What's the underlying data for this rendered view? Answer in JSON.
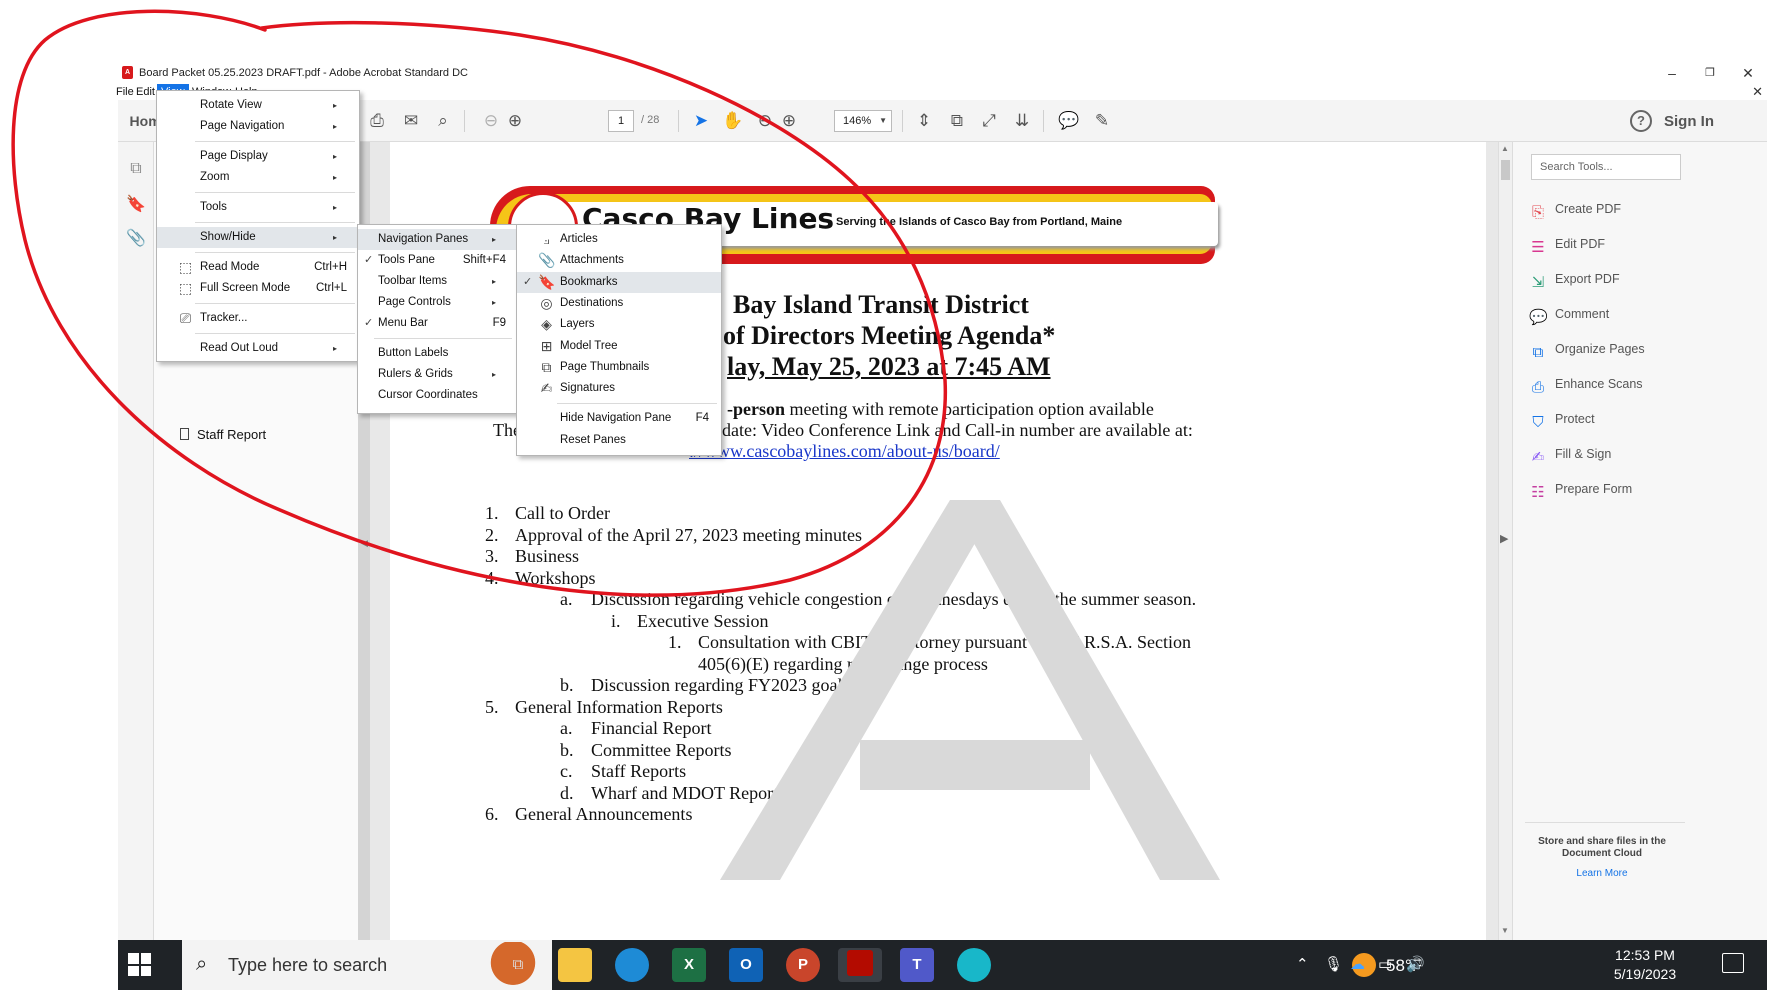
{
  "window": {
    "title": "Board Packet 05.25.2023 DRAFT.pdf - Adobe Acrobat Standard DC",
    "menus": [
      "File",
      "Edit",
      "View",
      "Window",
      "Help"
    ],
    "active_menu": "View"
  },
  "toolbar": {
    "home_label": "Home",
    "page_current": "1",
    "page_total": "/ 28",
    "zoom": "146%",
    "sign_in": "Sign In",
    "help": "?"
  },
  "nav_pane": {
    "bookmark_item": "Staff Report"
  },
  "view_menu": {
    "items": [
      {
        "label": "Rotate View",
        "shortcut": "",
        "submenu": true
      },
      {
        "label": "Page Navigation",
        "shortcut": "",
        "submenu": true
      },
      {
        "label": "Page Display",
        "shortcut": "",
        "submenu": true
      },
      {
        "label": "Zoom",
        "shortcut": "",
        "submenu": true
      },
      {
        "label": "Tools",
        "shortcut": "",
        "submenu": true
      },
      {
        "label": "Show/Hide",
        "shortcut": "",
        "submenu": true
      },
      {
        "label": "Read Mode",
        "shortcut": "Ctrl+H",
        "submenu": false
      },
      {
        "label": "Full Screen Mode",
        "shortcut": "Ctrl+L",
        "submenu": false
      },
      {
        "label": "Tracker...",
        "shortcut": "",
        "submenu": false
      },
      {
        "label": "Read Out Loud",
        "shortcut": "",
        "submenu": true
      }
    ]
  },
  "showhide_menu": {
    "items": [
      {
        "label": "Navigation Panes",
        "shortcut": "",
        "submenu": true,
        "checked": false
      },
      {
        "label": "Tools Pane",
        "shortcut": "Shift+F4",
        "submenu": false,
        "checked": true
      },
      {
        "label": "Toolbar Items",
        "shortcut": "",
        "submenu": true,
        "checked": false
      },
      {
        "label": "Page Controls",
        "shortcut": "",
        "submenu": true,
        "checked": false
      },
      {
        "label": "Menu Bar",
        "shortcut": "F9",
        "submenu": false,
        "checked": true
      },
      {
        "label": "Button Labels",
        "shortcut": "",
        "submenu": false,
        "checked": false
      },
      {
        "label": "Rulers & Grids",
        "shortcut": "",
        "submenu": true,
        "checked": false
      },
      {
        "label": "Cursor Coordinates",
        "shortcut": "",
        "submenu": false,
        "checked": false
      }
    ]
  },
  "navpanes_menu": {
    "items": [
      {
        "label": "Articles",
        "icon": "articles-icon",
        "checked": false
      },
      {
        "label": "Attachments",
        "icon": "paperclip-icon",
        "checked": false
      },
      {
        "label": "Bookmarks",
        "icon": "bookmark-icon",
        "checked": true
      },
      {
        "label": "Destinations",
        "icon": "destinations-icon",
        "checked": false
      },
      {
        "label": "Layers",
        "icon": "layers-icon",
        "checked": false
      },
      {
        "label": "Model Tree",
        "icon": "model-tree-icon",
        "checked": false
      },
      {
        "label": "Page Thumbnails",
        "icon": "page-thumbnails-icon",
        "checked": false
      },
      {
        "label": "Signatures",
        "icon": "signature-icon",
        "checked": false
      },
      {
        "label": "Hide Navigation Pane",
        "shortcut": "F4",
        "icon": "",
        "checked": false
      },
      {
        "label": "Reset Panes",
        "icon": "",
        "checked": false
      }
    ]
  },
  "document": {
    "logo_name": "Casco Bay Lines",
    "logo_tagline": "Serving the Islands of Casco Bay from Portland, Maine",
    "heading1": "Bay Island Transit District",
    "heading2": "of Directors Meeting Agenda*",
    "heading3": "lay, May 25, 2023 at 7:45 AM",
    "meeting_line_bold": "-person",
    "meeting_line": " meeting with remote participation option available",
    "conf_prefix": "The",
    "conf_line": "date: Video Conference Link and Call-in number are available at:",
    "conf_link": "://www.cascobaylines.com/about-us/board/",
    "agenda": [
      {
        "num": "1.",
        "text": "Call to Order",
        "indent": 0
      },
      {
        "num": "2.",
        "text": "Approval of the April 27, 2023 meeting minutes",
        "indent": 0
      },
      {
        "num": "3.",
        "text": "Business",
        "indent": 0
      },
      {
        "num": "4.",
        "text": "Workshops",
        "indent": 0
      },
      {
        "num": "a.",
        "text": "Discussion regarding vehicle congestion on Wednesdays during the summer season.",
        "indent": 1
      },
      {
        "num": "i.",
        "text": "Executive Session",
        "indent": 2
      },
      {
        "num": "1.",
        "text": "Consultation with CBITD’s attorney pursuant to 1 M.R.S.A. Section",
        "indent": 3
      },
      {
        "num": "",
        "text": "405(6)(E) regarding rate change process",
        "indent": 4
      },
      {
        "num": "b.",
        "text": "Discussion regarding FY2023 goals",
        "indent": 1
      },
      {
        "num": "5.",
        "text": "General Information Reports",
        "indent": 0
      },
      {
        "num": "a.",
        "text": "Financial Report",
        "indent": 1
      },
      {
        "num": "b.",
        "text": "Committee Reports",
        "indent": 1
      },
      {
        "num": "c.",
        "text": "Staff Reports",
        "indent": 1
      },
      {
        "num": "d.",
        "text": "Wharf and MDOT Reports",
        "indent": 1
      },
      {
        "num": "6.",
        "text": "General Announcements",
        "indent": 0
      }
    ]
  },
  "right_panel": {
    "search_placeholder": "Search Tools...",
    "tools": [
      {
        "label": "Create PDF",
        "icon": "create-pdf-icon",
        "color": "#e34850"
      },
      {
        "label": "Edit PDF",
        "icon": "edit-pdf-icon",
        "color": "#d83790"
      },
      {
        "label": "Export PDF",
        "icon": "export-pdf-icon",
        "color": "#2d9d78"
      },
      {
        "label": "Comment",
        "icon": "comment-icon",
        "color": "#f5b21b"
      },
      {
        "label": "Organize Pages",
        "icon": "organize-pages-icon",
        "color": "#1473e6"
      },
      {
        "label": "Enhance Scans",
        "icon": "enhance-scans-icon",
        "color": "#1473e6"
      },
      {
        "label": "Protect",
        "icon": "protect-icon",
        "color": "#1473e6"
      },
      {
        "label": "Fill & Sign",
        "icon": "fill-sign-icon",
        "color": "#8b5cf6"
      },
      {
        "label": "Prepare Form",
        "icon": "prepare-form-icon",
        "color": "#c43ea0"
      }
    ],
    "cloud_text": "Store and share files in the Document Cloud",
    "learn_more": "Learn More"
  },
  "taskbar": {
    "search_text": "Type here to search",
    "weather": "58°F",
    "time": "12:53 PM",
    "date": "5/19/2023"
  },
  "colors": {
    "accent": "#1473e6",
    "annotation": "#e0141e",
    "logo_red": "#d7191c",
    "logo_yellow": "#f5c518"
  }
}
